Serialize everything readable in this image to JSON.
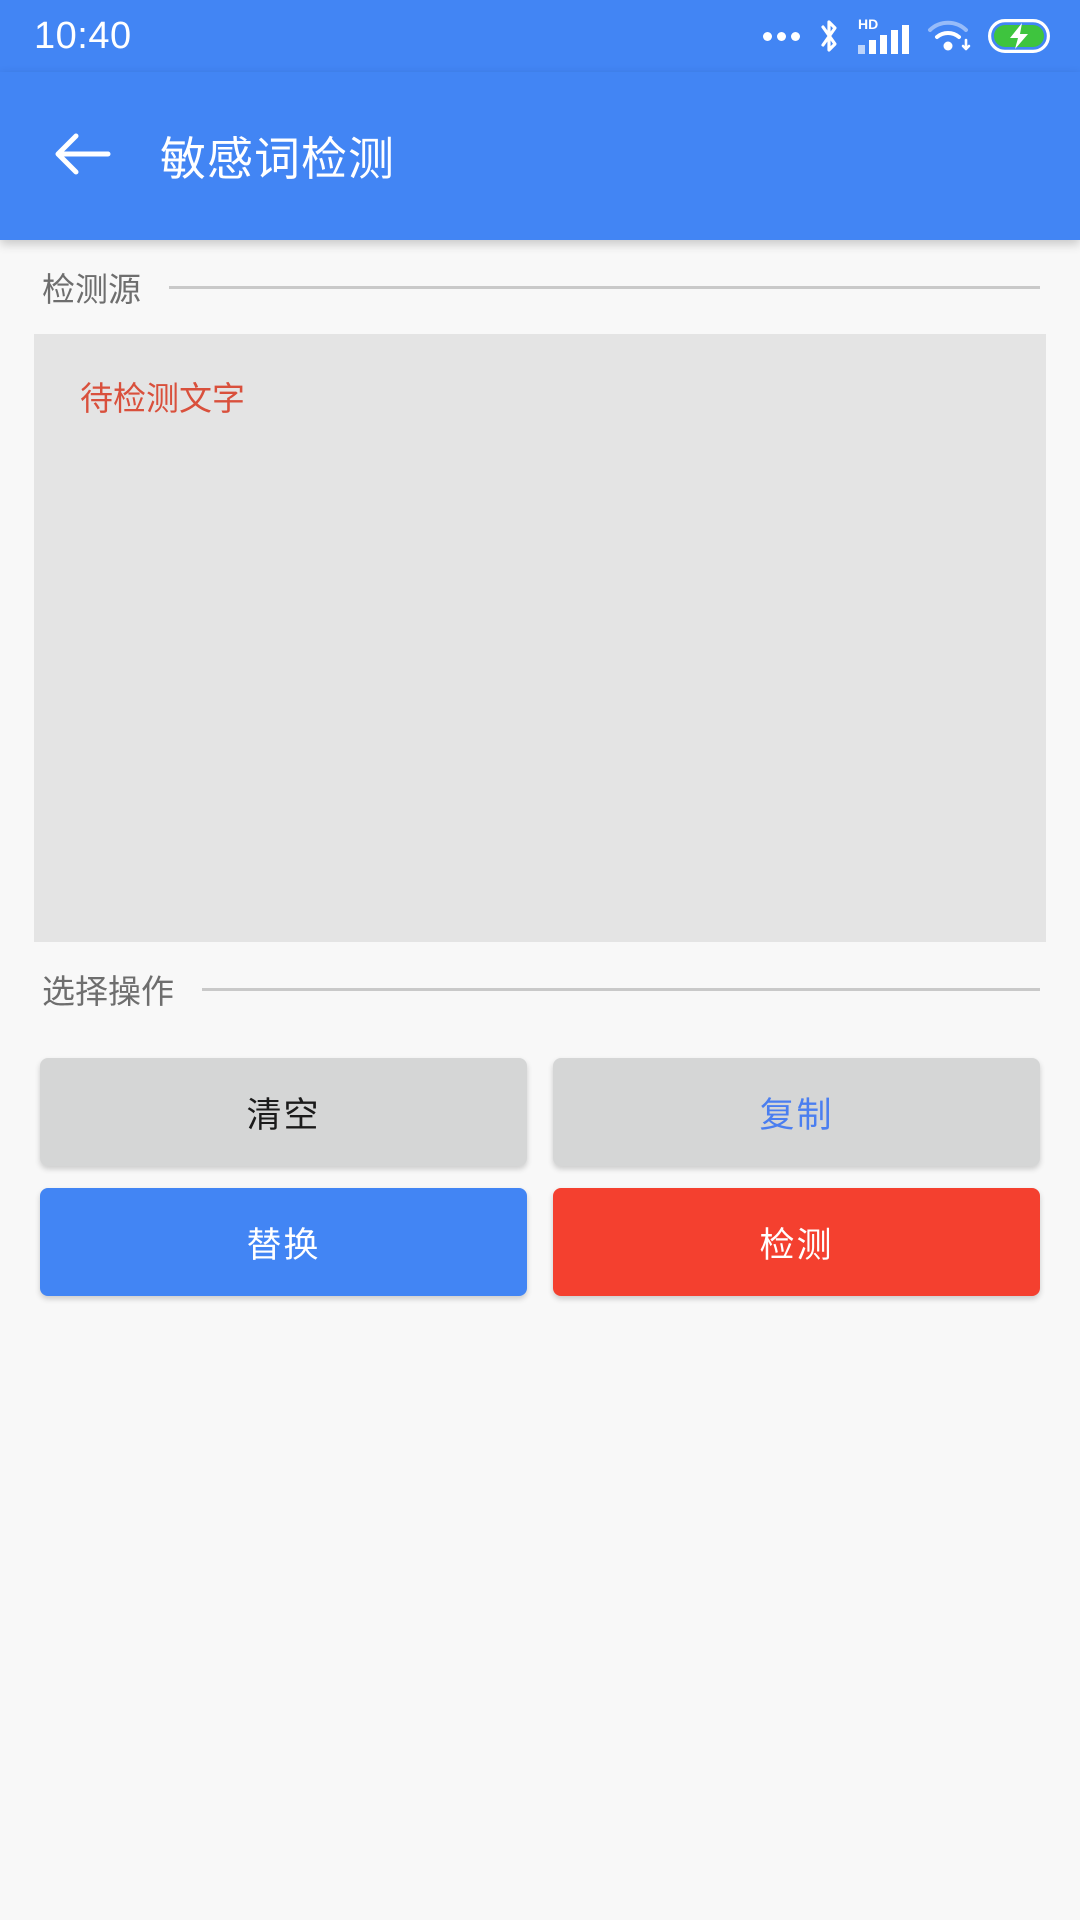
{
  "status_bar": {
    "time": "10:40",
    "icons": [
      "more-dots-icon",
      "bluetooth-icon",
      "hd-signal-icon",
      "wifi-icon",
      "battery-charging-icon"
    ],
    "hd_label": "HD"
  },
  "app_bar": {
    "back_icon": "back-arrow-icon",
    "title": "敏感词检测"
  },
  "sections": {
    "source": {
      "label": "检测源",
      "placeholder": "待检测文字",
      "value": ""
    },
    "operations": {
      "label": "选择操作"
    }
  },
  "buttons": [
    {
      "label": "清空",
      "style": "btn-grey"
    },
    {
      "label": "复制",
      "style": "btn-grey-blue"
    },
    {
      "label": "替换",
      "style": "btn-blue"
    },
    {
      "label": "检测",
      "style": "btn-red"
    }
  ],
  "colors": {
    "primary_blue": "#4285f4",
    "danger_red": "#f4402f",
    "placeholder_red": "#d9503c",
    "button_grey": "#d5d6d6",
    "copy_blue": "#4a7ef0",
    "page_background": "#f8f8f8",
    "textarea_background": "#e4e4e4",
    "battery_green": "#3ec43e"
  }
}
